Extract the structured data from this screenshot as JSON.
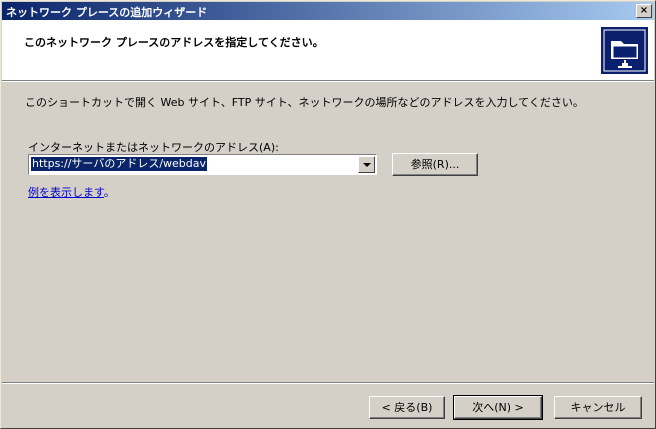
{
  "window": {
    "title": "ネットワーク プレースの追加ウィザード",
    "close_label": "×"
  },
  "header": {
    "title": "このネットワーク プレースのアドレスを指定してください。",
    "icon": "network-folder-icon"
  },
  "main": {
    "description": "このショートカットで開く Web サイト、FTP サイト、ネットワークの場所などのアドレスを入力してください。",
    "address_label": "インターネットまたはネットワークのアドレス(A):",
    "address_value": "https://サーバのアドレス/webdav",
    "browse_label": "参照(R)...",
    "examples_link": "例を表示します",
    "examples_suffix": "。"
  },
  "footer": {
    "back_label": "< 戻る(B)",
    "next_label": "次へ(N) >",
    "cancel_label": "キャンセル"
  },
  "colors": {
    "titlebar_start": "#0a246a",
    "titlebar_end": "#a6caf0",
    "face": "#d4d0c8",
    "link": "#0000cc"
  }
}
